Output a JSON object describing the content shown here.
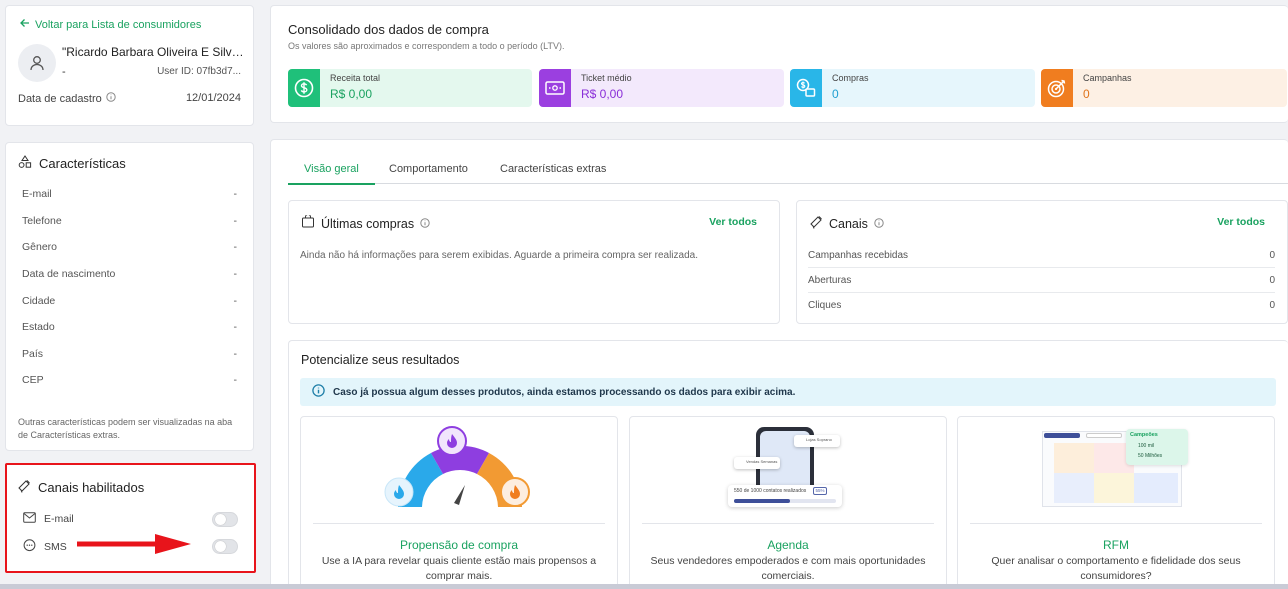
{
  "profile": {
    "back_link": "Voltar para Lista de consumidores",
    "name": "\"Ricardo Barbara Oliveira E Silva...",
    "sub": "-",
    "user_id": "User ID: 07fb3d7...",
    "reg_label": "Data de cadastro",
    "reg_date": "12/01/2024"
  },
  "characteristics": {
    "title": "Características",
    "rows": [
      {
        "label": "E-mail",
        "value": "-"
      },
      {
        "label": "Telefone",
        "value": "-"
      },
      {
        "label": "Gênero",
        "value": "-"
      },
      {
        "label": "Data de nascimento",
        "value": "-"
      },
      {
        "label": "Cidade",
        "value": "-"
      },
      {
        "label": "Estado",
        "value": "-"
      },
      {
        "label": "País",
        "value": "-"
      },
      {
        "label": "CEP",
        "value": "-"
      }
    ],
    "note": "Outras características podem ser visualizadas na aba de Características extras."
  },
  "enabled_channels": {
    "title": "Canais habilitados",
    "items": [
      {
        "label": "E-mail",
        "enabled": false
      },
      {
        "label": "SMS",
        "enabled": false
      }
    ]
  },
  "consolidated": {
    "title": "Consolidado dos dados de compra",
    "subtitle": "Os valores são aproximados e correspondem a todo o período (LTV).",
    "kpis": [
      {
        "label": "Receita total",
        "value": "R$ 0,00",
        "icon": "dollar-icon",
        "accent": "#1fc07a",
        "bg": "#e4f8ee",
        "color": "#1aa260"
      },
      {
        "label": "Ticket médio",
        "value": "R$ 0,00",
        "icon": "ticket-icon",
        "accent": "#9b3fe0",
        "bg": "#f3e9fc",
        "color": "#8a2ed8"
      },
      {
        "label": "Compras",
        "value": "0",
        "icon": "purchases-icon",
        "accent": "#29b6e8",
        "bg": "#e6f6fc",
        "color": "#1f9fd1"
      },
      {
        "label": "Campanhas",
        "value": "0",
        "icon": "target-icon",
        "accent": "#f07d1f",
        "bg": "#fdf0e4",
        "color": "#e0731a"
      }
    ]
  },
  "tabs": [
    {
      "label": "Visão geral",
      "active": true
    },
    {
      "label": "Comportamento",
      "active": false
    },
    {
      "label": "Características extras",
      "active": false
    }
  ],
  "last_purchases": {
    "title": "Últimas compras",
    "see_all": "Ver todos",
    "empty": "Ainda não há informações para serem exibidas. Aguarde a primeira compra ser realizada."
  },
  "channels": {
    "title": "Canais",
    "see_all": "Ver todos",
    "rows": [
      {
        "label": "Campanhas recebidas",
        "value": "0"
      },
      {
        "label": "Aberturas",
        "value": "0"
      },
      {
        "label": "Cliques",
        "value": "0"
      }
    ]
  },
  "boost": {
    "title": "Potencialize seus resultados",
    "info": "Caso já possua algum desses produtos, ainda estamos processando os dados para exibir acima.",
    "products": [
      {
        "title": "Propensão de compra",
        "desc": "Use a IA para revelar quais cliente estão mais propensos a comprar mais."
      },
      {
        "title": "Agenda",
        "desc": "Seus vendedores empoderados e com mais oportunidades comerciais."
      },
      {
        "title": "RFM",
        "desc": "Quer analisar o comportamento e fidelidade dos seus consumidores?"
      }
    ],
    "agenda_img": {
      "chip1": "Lojas Soprano",
      "chip2": "Vendas Semanas",
      "bar_text": "550 de 1000 contatos realizados",
      "bar_badge": "55%",
      "bar_progress": 0.55
    },
    "rfm_img": {
      "card_title": "Campeões",
      "stat1": "100 mil",
      "stat2": "50 Milhões"
    }
  }
}
